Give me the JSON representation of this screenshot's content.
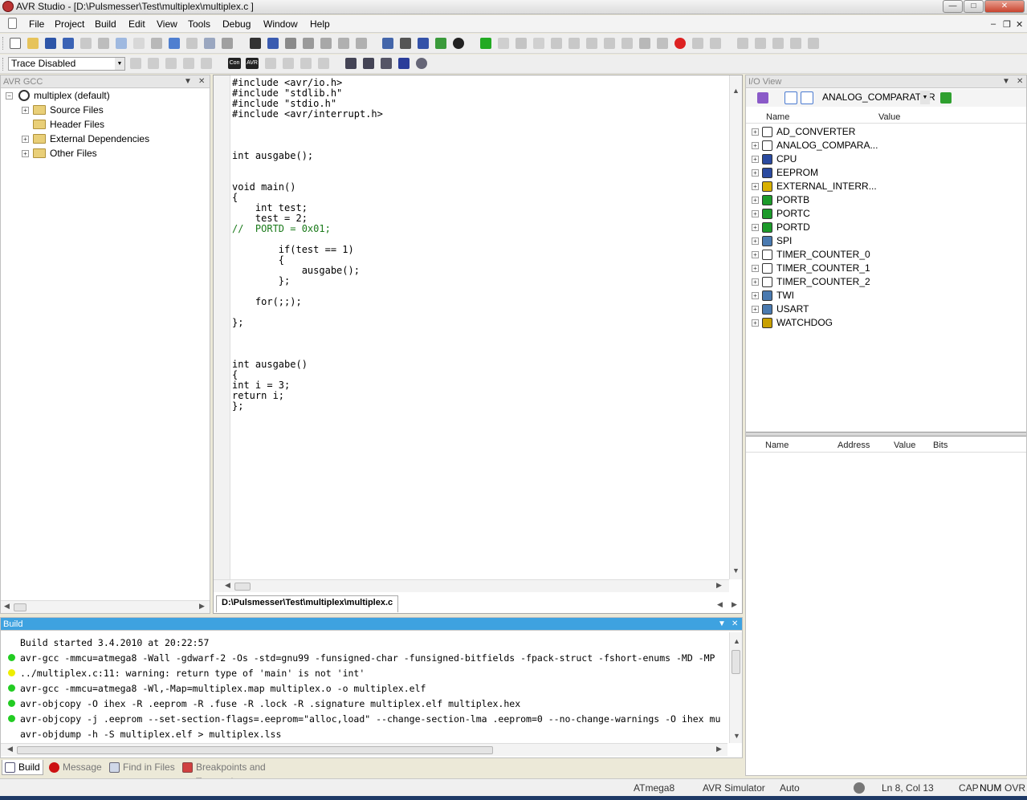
{
  "window": {
    "title": "AVR Studio - [D:\\Pulsmesser\\Test\\multiplex\\multiplex.c  ]",
    "minimize": "—",
    "maximize": "□",
    "close": "✕"
  },
  "menubar": {
    "items": [
      "File",
      "Project",
      "Build",
      "Edit",
      "View",
      "Tools",
      "Debug",
      "Window",
      "Help"
    ],
    "mdi_min": "–",
    "mdi_restore": "❐",
    "mdi_close": "✕"
  },
  "toolbar2": {
    "trace_select": "Trace Disabled",
    "con_label": "Con",
    "avr_label": "AVR"
  },
  "left_pane": {
    "title": "AVR GCC",
    "project": "multiplex (default)",
    "folders": [
      {
        "label": "Source Files",
        "expandable": true
      },
      {
        "label": "Header Files",
        "expandable": false
      },
      {
        "label": "External Dependencies",
        "expandable": true
      },
      {
        "label": "Other Files",
        "expandable": true
      }
    ]
  },
  "editor": {
    "file_tab": "D:\\Pulsmesser\\Test\\multiplex\\multiplex.c",
    "lines": [
      {
        "text": "#include <avr/io.h>",
        "type": "code"
      },
      {
        "text": "#include \"stdlib.h\"",
        "type": "code"
      },
      {
        "text": "#include \"stdio.h\"",
        "type": "code"
      },
      {
        "text": "#include <avr/interrupt.h>",
        "type": "code"
      },
      {
        "text": "",
        "type": "code"
      },
      {
        "text": "",
        "type": "code"
      },
      {
        "text": "",
        "type": "code"
      },
      {
        "text": "int ausgabe();",
        "type": "code"
      },
      {
        "text": "",
        "type": "code"
      },
      {
        "text": "",
        "type": "code"
      },
      {
        "text": "void main()",
        "type": "code"
      },
      {
        "text": "{",
        "type": "code"
      },
      {
        "text": "    int test;",
        "type": "code"
      },
      {
        "text": "    test = 2;",
        "type": "code"
      },
      {
        "text": "//  PORTD = 0x01;",
        "type": "comment"
      },
      {
        "text": "",
        "type": "code"
      },
      {
        "text": "        if(test == 1)",
        "type": "code"
      },
      {
        "text": "        {",
        "type": "code"
      },
      {
        "text": "            ausgabe();",
        "type": "code"
      },
      {
        "text": "        };",
        "type": "code"
      },
      {
        "text": "",
        "type": "code"
      },
      {
        "text": "    for(;;);",
        "type": "code"
      },
      {
        "text": "",
        "type": "code"
      },
      {
        "text": "};",
        "type": "code"
      },
      {
        "text": "",
        "type": "code"
      },
      {
        "text": "",
        "type": "code"
      },
      {
        "text": "",
        "type": "code"
      },
      {
        "text": "int ausgabe()",
        "type": "code"
      },
      {
        "text": "{",
        "type": "code"
      },
      {
        "text": "int i = 3;",
        "type": "code"
      },
      {
        "text": "return i;",
        "type": "code"
      },
      {
        "text": "};",
        "type": "code"
      }
    ]
  },
  "io_view": {
    "title": "I/O View",
    "dropdown": "ANALOG_COMPARATOR",
    "col_name": "Name",
    "col_value": "Value",
    "items": [
      {
        "label": "AD_CONVERTER",
        "icon": "adc-icon",
        "color": "#ffffff"
      },
      {
        "label": "ANALOG_COMPARA...",
        "icon": "comparator-icon",
        "color": "#ffffff"
      },
      {
        "label": "CPU",
        "icon": "cpu-icon",
        "color": "#2a4aa0"
      },
      {
        "label": "EEPROM",
        "icon": "eeprom-icon",
        "color": "#2a4aa0"
      },
      {
        "label": "EXTERNAL_INTERR...",
        "icon": "interrupt-icon",
        "color": "#d8b000"
      },
      {
        "label": "PORTB",
        "icon": "port-icon",
        "color": "#1c9a2a"
      },
      {
        "label": "PORTC",
        "icon": "port-icon",
        "color": "#1c9a2a"
      },
      {
        "label": "PORTD",
        "icon": "port-icon",
        "color": "#1c9a2a"
      },
      {
        "label": "SPI",
        "icon": "spi-icon",
        "color": "#4a7ab0"
      },
      {
        "label": "TIMER_COUNTER_0",
        "icon": "timer-icon",
        "color": "#ffffff"
      },
      {
        "label": "TIMER_COUNTER_1",
        "icon": "timer-icon",
        "color": "#ffffff"
      },
      {
        "label": "TIMER_COUNTER_2",
        "icon": "timer-icon",
        "color": "#ffffff"
      },
      {
        "label": "TWI",
        "icon": "twi-icon",
        "color": "#4a7ab0"
      },
      {
        "label": "USART",
        "icon": "usart-icon",
        "color": "#4a7ab0"
      },
      {
        "label": "WATCHDOG",
        "icon": "watchdog-icon",
        "color": "#c8a000"
      }
    ],
    "detail_cols": [
      "Name",
      "Address",
      "Value",
      "Bits"
    ]
  },
  "build": {
    "title": "Build",
    "lines": [
      {
        "text": "Build started 3.4.2010 at 20:22:57",
        "status": "none"
      },
      {
        "text": "avr-gcc  -mmcu=atmega8 -Wall -gdwarf-2 -Os -std=gnu99 -funsigned-char -funsigned-bitfields -fpack-struct -fshort-enums -MD -MP",
        "status": "ok"
      },
      {
        "text": "../multiplex.c:11: warning: return type of 'main' is not 'int'",
        "status": "warn"
      },
      {
        "text": "avr-gcc -mmcu=atmega8 -Wl,-Map=multiplex.map multiplex.o     -o multiplex.elf",
        "status": "ok"
      },
      {
        "text": "avr-objcopy -O ihex -R .eeprom -R .fuse -R .lock -R .signature  multiplex.elf multiplex.hex",
        "status": "ok"
      },
      {
        "text": "avr-objcopy -j .eeprom --set-section-flags=.eeprom=\"alloc,load\" --change-section-lma .eeprom=0 --no-change-warnings -O ihex mu",
        "status": "ok"
      },
      {
        "text": "avr-objdump -h -S multiplex.elf > multiplex.lss",
        "status": "none"
      }
    ],
    "colors": {
      "ok": "#22cc22",
      "warn": "#eeee00"
    }
  },
  "bottom_tabs": [
    {
      "label": "Build",
      "selected": true,
      "icon": "build-icon"
    },
    {
      "label": "Message",
      "selected": false,
      "icon": "message-icon"
    },
    {
      "label": "Find in Files",
      "selected": false,
      "icon": "find-icon"
    },
    {
      "label": "Breakpoints and Tracepoints",
      "selected": false,
      "icon": "breakpoints-icon"
    }
  ],
  "statusbar": {
    "device": "ATmega8",
    "platform": "AVR Simulator",
    "mode": "Auto",
    "position": "Ln 8, Col 13",
    "cap": "CAP",
    "num": "NUM",
    "ovr": "OVR"
  }
}
